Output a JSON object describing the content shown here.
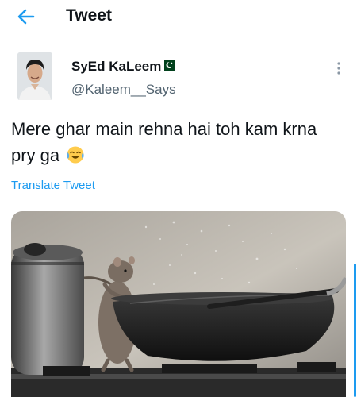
{
  "header": {
    "title": "Tweet",
    "back_icon": "arrow-left-icon"
  },
  "tweet": {
    "author": {
      "display_name": "SyEd KaLeem",
      "handle": "@Kaleem__Says",
      "flag_icon": "pakistan-flag-icon",
      "avatar_icon": "user-avatar"
    },
    "text": "Mere ghar main rehna hai toh kam krna pry ga",
    "emoji_icon": "face-with-tears-of-joy-icon",
    "translate_label": "Translate Tweet",
    "more_icon": "more-vertical-icon",
    "media_icon": "photo-rat-with-frying-pan"
  },
  "colors": {
    "accent": "#1d9bf0",
    "text_primary": "#0f1419",
    "text_secondary": "#536471",
    "flag_green": "#01411c"
  }
}
